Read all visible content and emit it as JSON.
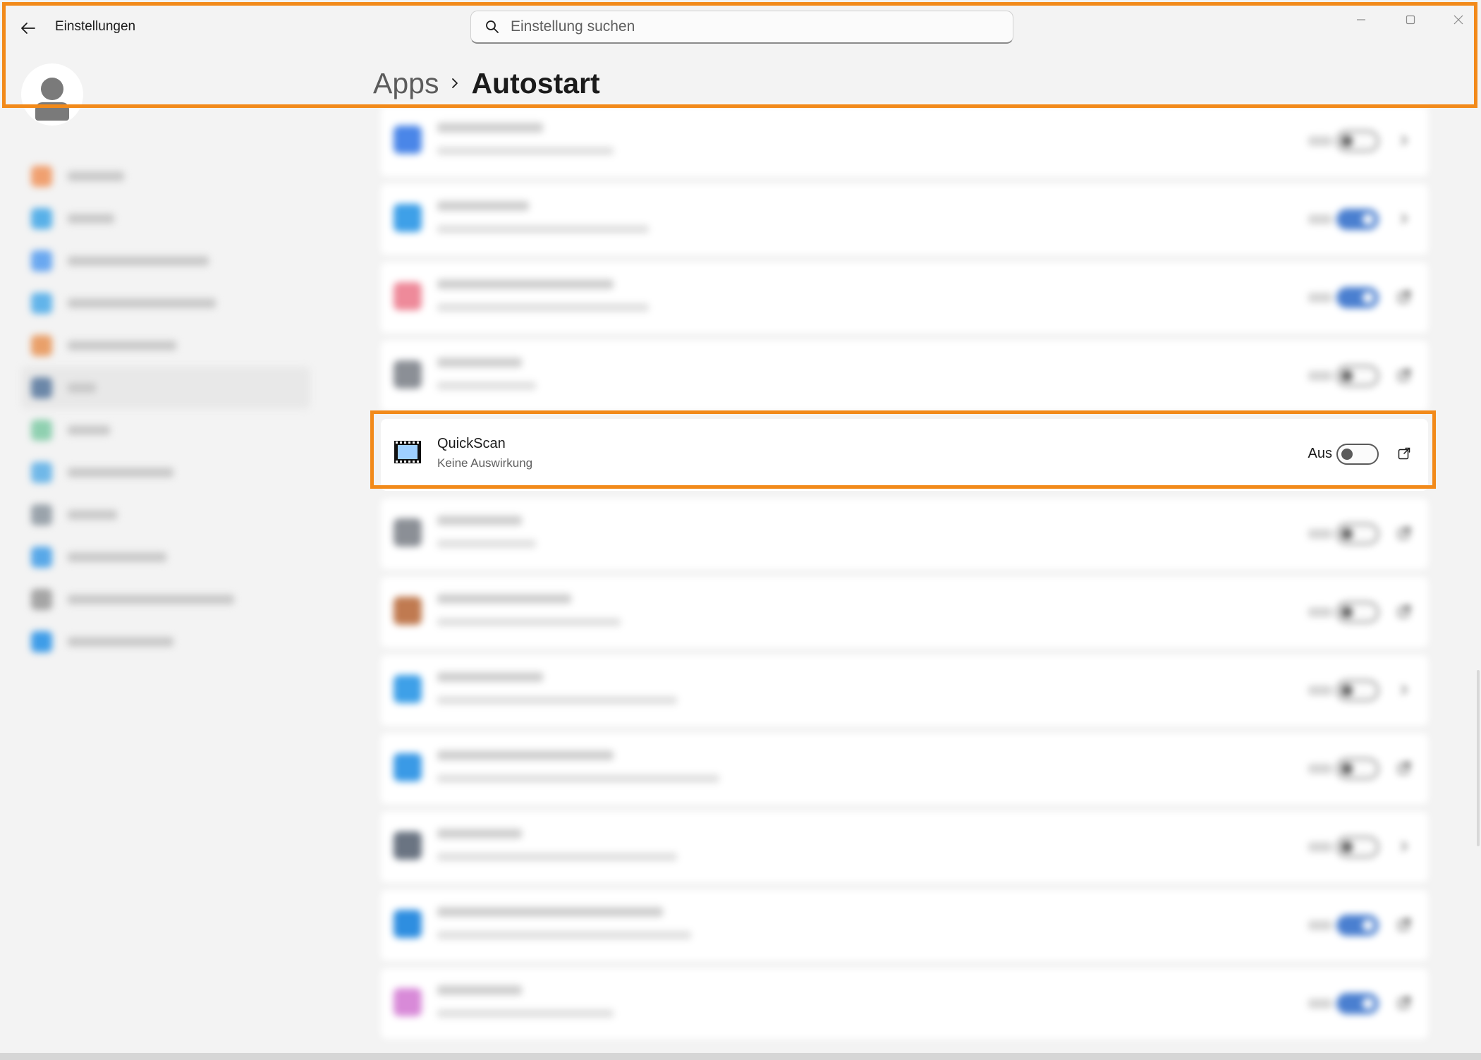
{
  "window": {
    "title": "Einstellungen",
    "search_placeholder": "Einstellung suchen",
    "controls": [
      "minimize-icon",
      "maximize-icon",
      "close-icon"
    ]
  },
  "breadcrumb": {
    "parent": "Apps",
    "current": "Autostart"
  },
  "sidebar": {
    "items": [
      {
        "icon": "home-icon",
        "color": "#f0a070"
      },
      {
        "icon": "system-icon",
        "color": "#58b0e8"
      },
      {
        "icon": "bluetooth-icon",
        "color": "#6aa8f0"
      },
      {
        "icon": "network-icon",
        "color": "#62b4ea"
      },
      {
        "icon": "personalization-icon",
        "color": "#e9a06a"
      },
      {
        "icon": "apps-icon",
        "color": "#6b87a8",
        "selected": true
      },
      {
        "icon": "accounts-icon",
        "color": "#8fd0b0"
      },
      {
        "icon": "time-language-icon",
        "color": "#70b8e8"
      },
      {
        "icon": "gaming-icon",
        "color": "#9aa3ab"
      },
      {
        "icon": "accessibility-icon",
        "color": "#58a8e8"
      },
      {
        "icon": "privacy-icon",
        "color": "#a5a5a5"
      },
      {
        "icon": "windows-update-icon",
        "color": "#3f9de8"
      }
    ]
  },
  "startup_apps": [
    {
      "icon_color": "#4a86e8",
      "toggle_on": false,
      "ext_icon": "chevron-right-icon"
    },
    {
      "icon_color": "#3ea0e8",
      "toggle_on": true,
      "ext_icon": "chevron-right-icon"
    },
    {
      "icon_color": "#ee8a9a",
      "toggle_on": true,
      "ext_icon": "external-link-icon"
    },
    {
      "icon_color": "#8b8f96",
      "toggle_on": false,
      "ext_icon": "external-link-icon"
    },
    {
      "name": "QuickScan",
      "impact": "Keine Auswirkung",
      "state": "Aus",
      "toggle_on": false,
      "icon": "film-icon",
      "ext_icon": "external-link-icon",
      "focused": true
    },
    {
      "icon_color": "#8b8f96",
      "toggle_on": false,
      "ext_icon": "external-link-icon"
    },
    {
      "icon_color": "#c07a50",
      "toggle_on": false,
      "ext_icon": "external-link-icon"
    },
    {
      "icon_color": "#3ea0e8",
      "toggle_on": false,
      "ext_icon": "chevron-right-icon"
    },
    {
      "icon_color": "#3a9ae6",
      "toggle_on": false,
      "ext_icon": "external-link-icon"
    },
    {
      "icon_color": "#6a7482",
      "toggle_on": false,
      "ext_icon": "chevron-right-icon"
    },
    {
      "icon_color": "#2e8ee0",
      "toggle_on": true,
      "ext_icon": "external-link-icon"
    },
    {
      "icon_color": "#d88ad8",
      "toggle_on": true,
      "ext_icon": "external-link-icon"
    }
  ],
  "colors": {
    "highlight": "#f28a1a",
    "toggle_on": "#4a7fd0",
    "background": "#f3f3f3"
  }
}
